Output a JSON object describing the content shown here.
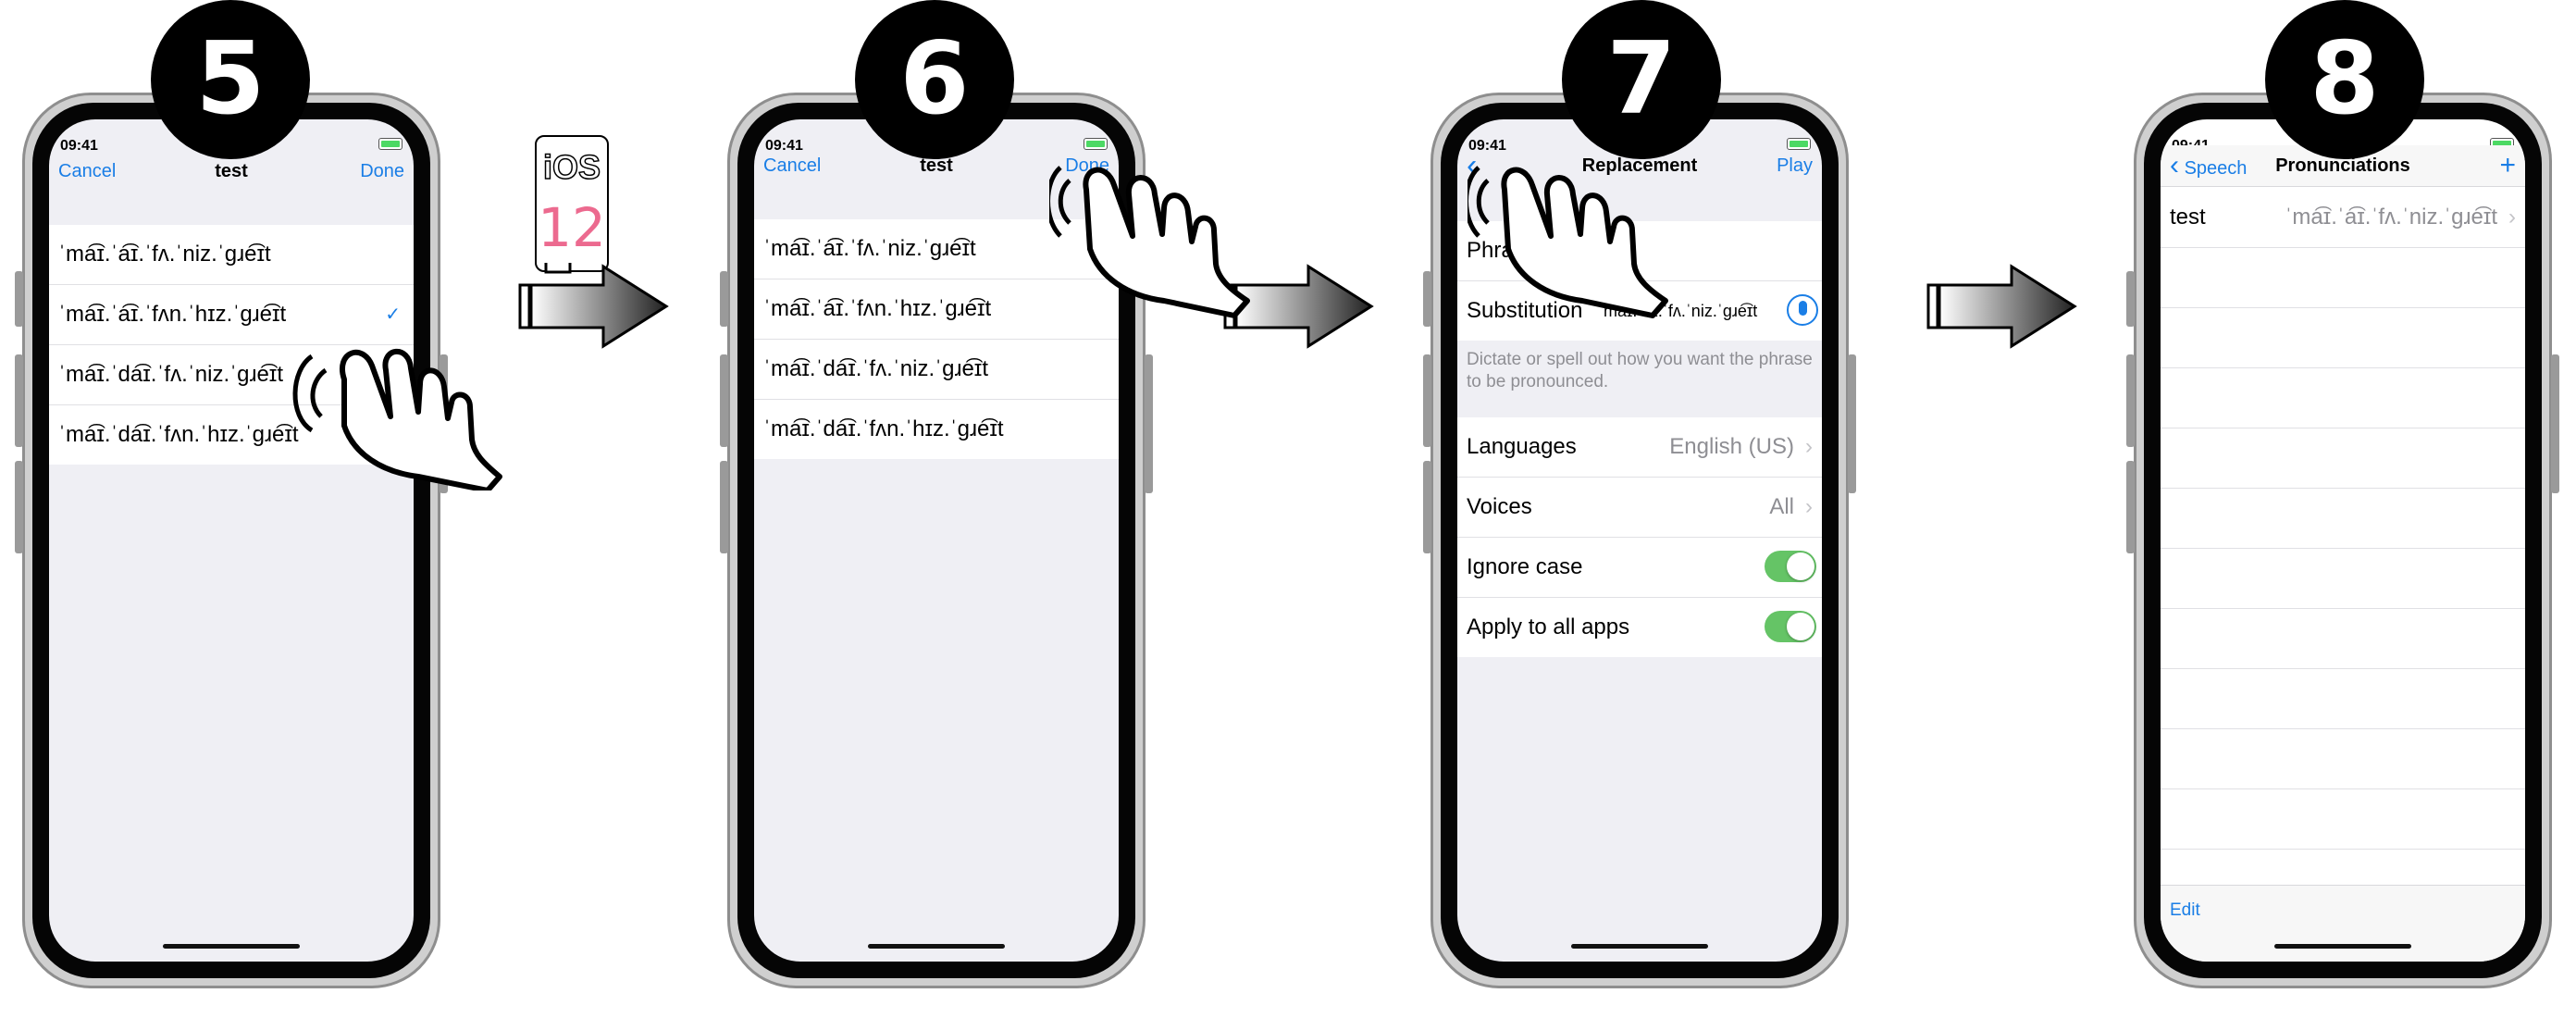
{
  "steps": [
    "5",
    "6",
    "7",
    "8"
  ],
  "status_time": "09:41",
  "ios_badge": {
    "label": "iOS",
    "version": "12"
  },
  "phone5": {
    "nav": {
      "cancel": "Cancel",
      "title": "test",
      "done": "Done"
    },
    "items": [
      "ˈma͡ɪ.ˈa͡ɪ.ˈfʌ.ˈniz.ˈɡɹe͡ɪt",
      "ˈma͡ɪ.ˈa͡ɪ.ˈfʌn.ˈhɪz.ˈɡɹe͡ɪt",
      "ˈma͡ɪ.ˈda͡ɪ.ˈfʌ.ˈniz.ˈɡɹe͡ɪt",
      "ˈma͡ɪ.ˈda͡ɪ.ˈfʌn.ˈhɪz.ˈɡɹe͡ɪt"
    ],
    "check_mark": "✓"
  },
  "phone6": {
    "nav": {
      "cancel": "Cancel",
      "title": "test",
      "done": "Done"
    },
    "items": [
      "ˈma͡ɪ.ˈa͡ɪ.ˈfʌ.ˈniz.ˈɡɹe͡ɪt",
      "ˈma͡ɪ.ˈa͡ɪ.ˈfʌn.ˈhɪz.ˈɡɹe͡ɪt",
      "ˈma͡ɪ.ˈda͡ɪ.ˈfʌ.ˈniz.ˈɡɹe͡ɪt",
      "ˈma͡ɪ.ˈda͡ɪ.ˈfʌn.ˈhɪz.ˈɡɹe͡ɪt"
    ],
    "check_mark": "✓"
  },
  "phone7": {
    "nav": {
      "back": "‹",
      "title": "Replacement",
      "play": "Play"
    },
    "phrase_label": "Phrase",
    "substitution_label": "Substitution",
    "substitution_value": "ˈma͡ɪ.ˈa͡ɪ.ˈfʌ.ˈniz.ˈɡɹe͡ɪt",
    "footnote": "Dictate or spell out how you want the phrase to be pronounced.",
    "languages_label": "Languages",
    "languages_value": "English (US)",
    "voices_label": "Voices",
    "voices_value": "All",
    "ignore_case_label": "Ignore case",
    "ignore_case_on": true,
    "apply_all_label": "Apply to all apps",
    "apply_all_on": true,
    "chevron": "›"
  },
  "phone8": {
    "nav": {
      "back": "Speech",
      "title": "Pronunciations",
      "add": "+"
    },
    "row_label": "test",
    "row_value": "ˈma͡ɪ.ˈa͡ɪ.ˈfʌ.ˈniz.ˈɡɹe͡ɪt",
    "chevron": "›",
    "edit": "Edit"
  }
}
